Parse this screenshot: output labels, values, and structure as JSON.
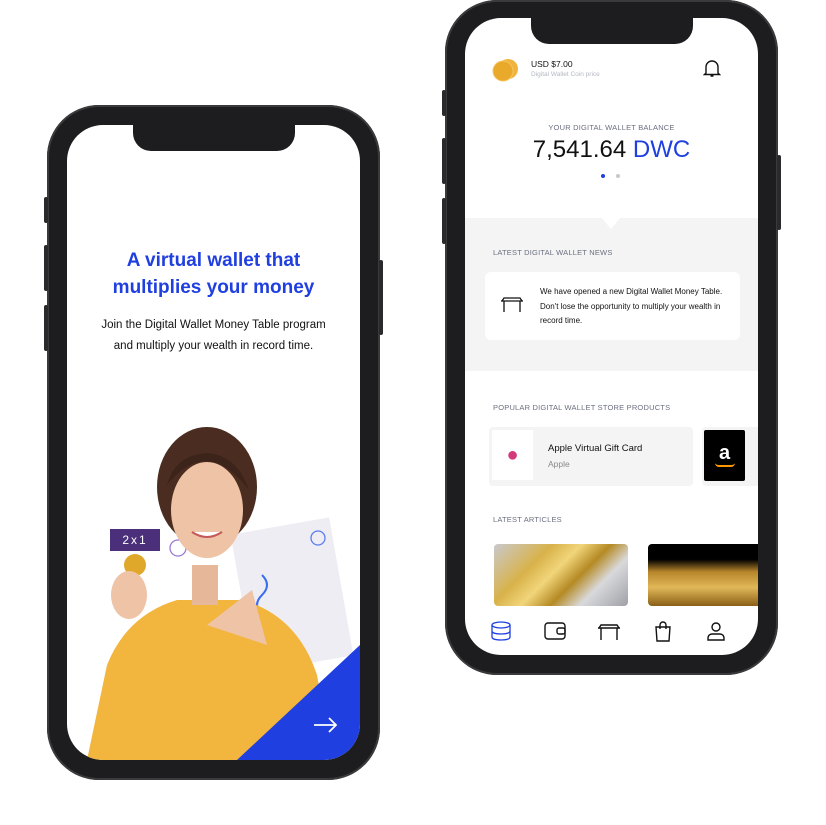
{
  "onboarding": {
    "title_line1": "A virtual wallet that",
    "title_line2": "multiplies your money",
    "subtitle_line1": "Join the Digital Wallet Money Table program",
    "subtitle_line2": "and multiply your wealth in record time.",
    "badge": "2x1",
    "next_icon": "arrow-right-icon",
    "accent": "#1f3fe0"
  },
  "dashboard": {
    "coin_price": "USD $7.00",
    "coin_price_label": "Digital Wallet Coin price",
    "balance_label": "YOUR DIGITAL WALLET BALANCE",
    "balance_value": "7,541.64",
    "balance_unit": "DWC",
    "news_heading": "LATEST DIGITAL WALLET NEWS",
    "news_text": "We have opened a new Digital Wallet Money Table. Don't lose the opportunity to multiply your wealth in record time.",
    "products_heading": "POPULAR DIGITAL WALLET STORE PRODUCTS",
    "products": [
      {
        "name": "Apple Virtual Gift Card",
        "brand": "Apple"
      },
      {
        "brand_logo": "a"
      }
    ],
    "articles_heading": "LATEST ARTICLES",
    "nav": [
      "database-icon",
      "wallet-icon",
      "table-icon",
      "shopping-bag-icon",
      "user-icon"
    ]
  }
}
